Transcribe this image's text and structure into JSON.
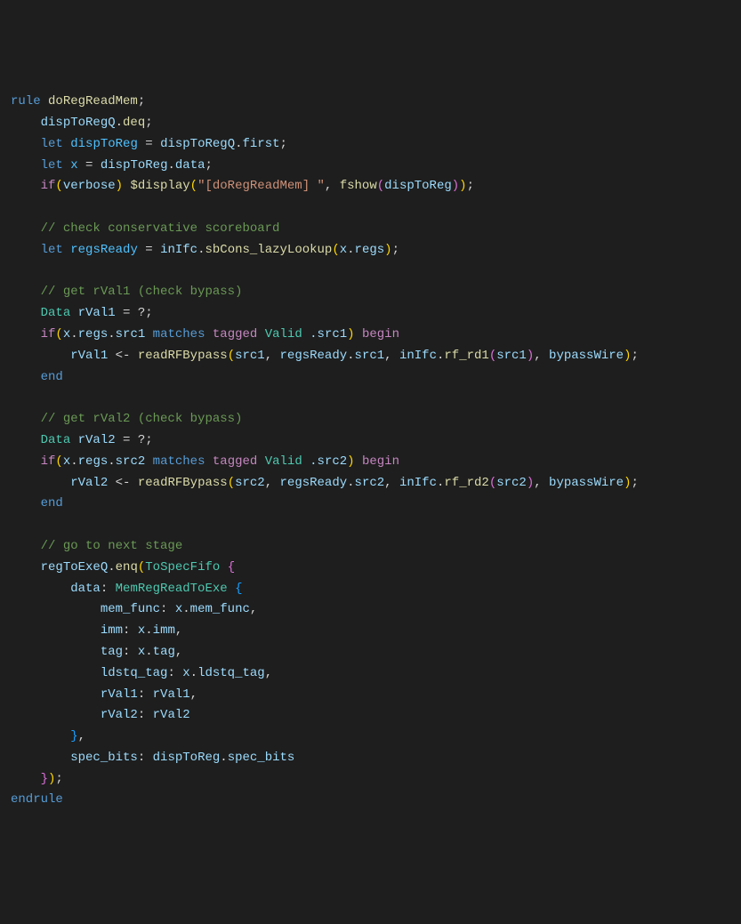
{
  "code": {
    "line1_rule": "rule",
    "line1_name": "doRegReadMem",
    "line2_disp": "dispToRegQ",
    "line2_deq": "deq",
    "line3_let": "let",
    "line3_var": "dispToReg",
    "line3_src": "dispToRegQ",
    "line3_first": "first",
    "line4_let": "let",
    "line4_x": "x",
    "line4_src": "dispToReg",
    "line4_data": "data",
    "line5_if": "if",
    "line5_verbose": "verbose",
    "line5_display": "$display",
    "line5_str": "\"[doRegReadMem] \"",
    "line5_fshow": "fshow",
    "line5_arg": "dispToReg",
    "line7_comment": "// check conservative scoreboard",
    "line8_let": "let",
    "line8_var": "regsReady",
    "line8_inIfc": "inIfc",
    "line8_method": "sbCons_lazyLookup",
    "line8_x": "x",
    "line8_regs": "regs",
    "line10_comment": "// get rVal1 (check bypass)",
    "line11_Data": "Data",
    "line11_rVal1": "rVal1",
    "line12_if": "if",
    "line12_x": "x",
    "line12_regs": "regs",
    "line12_src1": "src1",
    "line12_matches": "matches",
    "line12_tagged": "tagged",
    "line12_Valid": "Valid",
    "line12_pat": ".src1",
    "line12_begin": "begin",
    "line13_rVal1": "rVal1",
    "line13_read": "readRFBypass",
    "line13_src1": "src1",
    "line13_regsReady": "regsReady",
    "line13_rr_src1": "src1",
    "line13_inIfc": "inIfc",
    "line13_rf_rd1": "rf_rd1",
    "line13_bypass": "bypassWire",
    "line14_end": "end",
    "line16_comment": "// get rVal2 (check bypass)",
    "line17_Data": "Data",
    "line17_rVal2": "rVal2",
    "line18_if": "if",
    "line18_x": "x",
    "line18_regs": "regs",
    "line18_src2": "src2",
    "line18_matches": "matches",
    "line18_tagged": "tagged",
    "line18_Valid": "Valid",
    "line18_pat": ".src2",
    "line18_begin": "begin",
    "line19_rVal2": "rVal2",
    "line19_read": "readRFBypass",
    "line19_src2": "src2",
    "line19_regsReady": "regsReady",
    "line19_rr_src2": "src2",
    "line19_inIfc": "inIfc",
    "line19_rf_rd2": "rf_rd2",
    "line19_bypass": "bypassWire",
    "line20_end": "end",
    "line22_comment": "// go to next stage",
    "line23_regToExeQ": "regToExeQ",
    "line23_enq": "enq",
    "line23_ToSpecFifo": "ToSpecFifo",
    "line24_data": "data",
    "line24_MemReg": "MemRegReadToExe",
    "line25_mem_func": "mem_func",
    "line25_x": "x",
    "line25_xmem": "mem_func",
    "line26_imm": "imm",
    "line26_x": "x",
    "line26_ximm": "imm",
    "line27_tag": "tag",
    "line27_x": "x",
    "line27_xtag": "tag",
    "line28_ldstq": "ldstq_tag",
    "line28_x": "x",
    "line28_xldstq": "ldstq_tag",
    "line29_rVal1f": "rVal1",
    "line29_rVal1v": "rVal1",
    "line30_rVal2f": "rVal2",
    "line30_rVal2v": "rVal2",
    "line32_spec": "spec_bits",
    "line32_disp": "dispToReg",
    "line32_sb": "spec_bits",
    "line34_endrule": "endrule"
  }
}
